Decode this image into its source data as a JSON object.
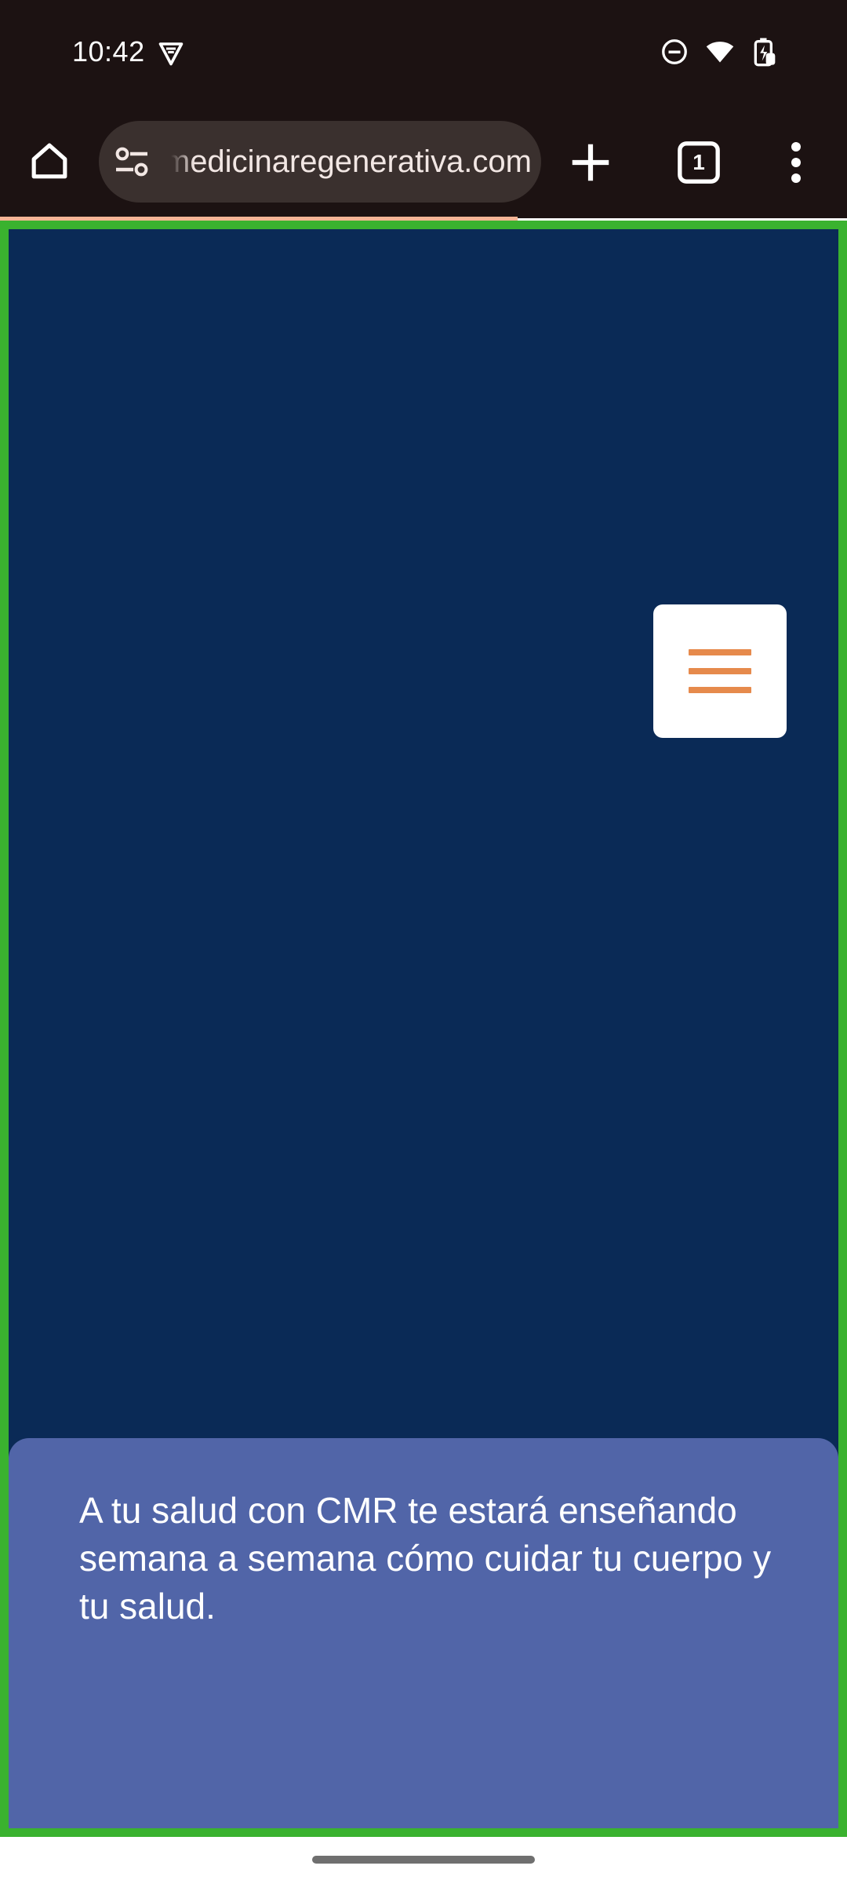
{
  "status_bar": {
    "time": "10:42",
    "icons": [
      "vpn-icon",
      "do-not-disturb-icon",
      "wifi-icon",
      "battery-charging-icon"
    ]
  },
  "browser": {
    "url": "centrodemedicinaregenerativa.com",
    "tab_count": "1",
    "icons": [
      "home-icon",
      "site-settings-icon",
      "new-tab-icon",
      "tab-switcher-icon",
      "more-options-icon"
    ]
  },
  "page": {
    "menu_icon": "hamburger-menu-icon",
    "info_text": "A tu salud con CMR te estará enseñando semana a semana cómo cuidar tu cuerpo y tu salud."
  },
  "colors": {
    "system_bar_bg": "#1c1212",
    "page_bg": "#0a2a56",
    "card_bg": "#5165a8",
    "accent_orange": "#e68a4c",
    "highlight_border": "#3ab22f"
  }
}
